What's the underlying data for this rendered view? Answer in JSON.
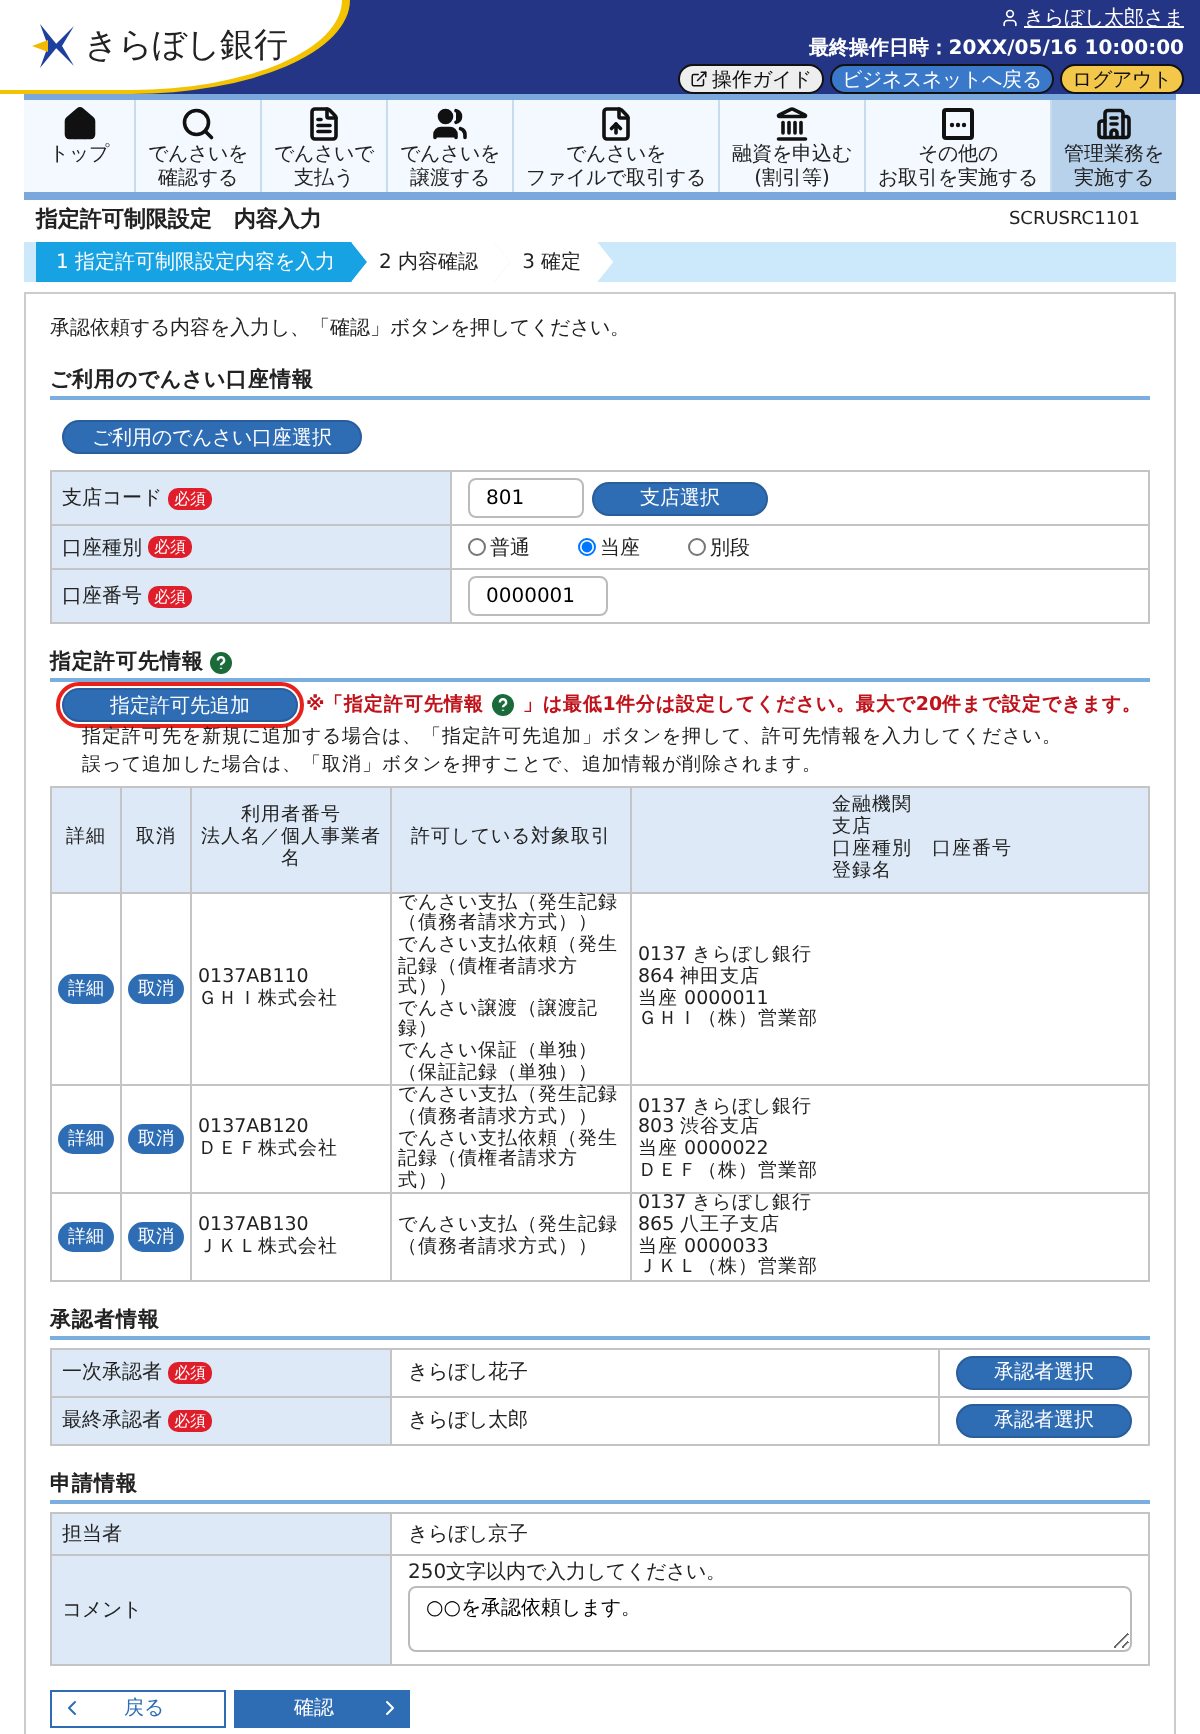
{
  "header": {
    "bank_name": "きらぼし銀行",
    "user": "きらぼし太郎さま",
    "last_login": "最終操作日時：20XX/05/16 10:00:00",
    "buttons": [
      {
        "label": "操作ガイド",
        "kind": "guide"
      },
      {
        "label": "ビジネスネットへ戻る",
        "kind": "back"
      },
      {
        "label": "ログアウト",
        "kind": "logout"
      }
    ]
  },
  "nav": [
    {
      "lines": [
        "トップ"
      ],
      "kind": "home",
      "selected": false
    },
    {
      "lines": [
        "でんさいを",
        "確認する"
      ],
      "kind": "search",
      "selected": false
    },
    {
      "lines": [
        "でんさいで",
        "支払う"
      ],
      "kind": "pay",
      "selected": false
    },
    {
      "lines": [
        "でんさいを",
        "譲渡する"
      ],
      "kind": "transfer",
      "selected": false
    },
    {
      "lines": [
        "でんさいを",
        "ファイルで取引する"
      ],
      "kind": "file",
      "selected": false
    },
    {
      "lines": [
        "融資を申込む",
        "(割引等)"
      ],
      "kind": "bank",
      "selected": false
    },
    {
      "lines": [
        "その他の",
        "お取引を実施する"
      ],
      "kind": "etc",
      "selected": false
    },
    {
      "lines": [
        "管理業務を",
        "実施する"
      ],
      "kind": "admin",
      "selected": true
    }
  ],
  "page": {
    "title": "指定許可制限設定　内容入力",
    "screen_id": "SCRUSRC1101"
  },
  "steps": [
    {
      "label": "1 指定許可制限設定内容を入力",
      "selected": true
    },
    {
      "label": "2 内容確認",
      "selected": false
    },
    {
      "label": "3 確定",
      "selected": false
    }
  ],
  "intro": "承認依頼する内容を入力し、「確認」ボタンを押してください。",
  "account_section": {
    "heading": "ご利用のでんさい口座情報",
    "select_button": "ご利用のでんさい口座選択",
    "rows": [
      {
        "label": "支店コード",
        "badge": "必須",
        "kind": "code",
        "value": "801",
        "button": "支店選択"
      },
      {
        "label": "口座種別",
        "badge": "必須",
        "kind": "radio",
        "options": [
          {
            "label": "普通",
            "selected": false
          },
          {
            "label": "当座",
            "selected": true
          },
          {
            "label": "別段",
            "selected": false
          }
        ]
      },
      {
        "label": "口座番号",
        "badge": "必須",
        "kind": "text",
        "value": "0000001"
      }
    ]
  },
  "permit_section": {
    "heading": "指定許可先情報",
    "add_button": "指定許可先追加",
    "add_highlighted": true,
    "note_before": "※「指定許可先情報",
    "note_after": "」は最低1件分は設定してください。最大で20件まで設定できます。",
    "help": [
      "指定許可先を新規に追加する場合は、「指定許可先追加」ボタンを押して、許可先情報を入力してください。",
      "誤って追加した場合は、「取消」ボタンを押すことで、追加情報が削除されます。"
    ],
    "columns": [
      [
        "詳細"
      ],
      [
        "取消"
      ],
      [
        "利用者番号",
        "法人名／個人事業者名"
      ],
      [
        "許可している対象取引"
      ],
      [
        "金融機関",
        "支店",
        "口座種別　口座番号",
        "登録名"
      ]
    ],
    "rows": [
      {
        "detail": "詳細",
        "cancel": "取消",
        "user": [
          "0137AB110",
          "ＧＨＩ株式会社"
        ],
        "deals": [
          "でんさい支払（発生記録（債務者請求方式））",
          "でんさい支払依頼（発生記録（債権者請求方式））",
          "でんさい譲渡（譲渡記録）",
          "でんさい保証（単独）（保証記録（単独））"
        ],
        "bank": [
          "0137 きらぼし銀行",
          "864 神田支店",
          "当座 0000011",
          "ＧＨＩ（株）営業部"
        ]
      },
      {
        "detail": "詳細",
        "cancel": "取消",
        "user": [
          "0137AB120",
          "ＤＥＦ株式会社"
        ],
        "deals": [
          "でんさい支払（発生記録（債務者請求方式））",
          "でんさい支払依頼（発生記録（債権者請求方式））"
        ],
        "bank": [
          "0137 きらぼし銀行",
          "803 渋谷支店",
          "当座 0000022",
          "ＤＥＦ（株）営業部"
        ]
      },
      {
        "detail": "詳細",
        "cancel": "取消",
        "user": [
          "0137AB130",
          "ＪＫＬ株式会社"
        ],
        "deals": [
          "でんさい支払（発生記録（債務者請求方式））"
        ],
        "bank": [
          "0137 きらぼし銀行",
          "865 八王子支店",
          "当座 0000033",
          "ＪＫＬ（株）営業部"
        ]
      }
    ]
  },
  "approver_section": {
    "heading": "承認者情報",
    "rows": [
      {
        "label": "一次承認者",
        "badge": "必須",
        "value": "きらぼし花子",
        "button": "承認者選択"
      },
      {
        "label": "最終承認者",
        "badge": "必須",
        "value": "きらぼし太郎",
        "button": "承認者選択"
      }
    ]
  },
  "application_section": {
    "heading": "申請情報",
    "staff_label": "担当者",
    "staff": "きらぼし京子",
    "comment_label": "コメント",
    "comment_hint": "250文字以内で入力してください。",
    "comment": "○○を承認依頼します。"
  },
  "footer": {
    "back": "戻る",
    "confirm": "確認"
  }
}
